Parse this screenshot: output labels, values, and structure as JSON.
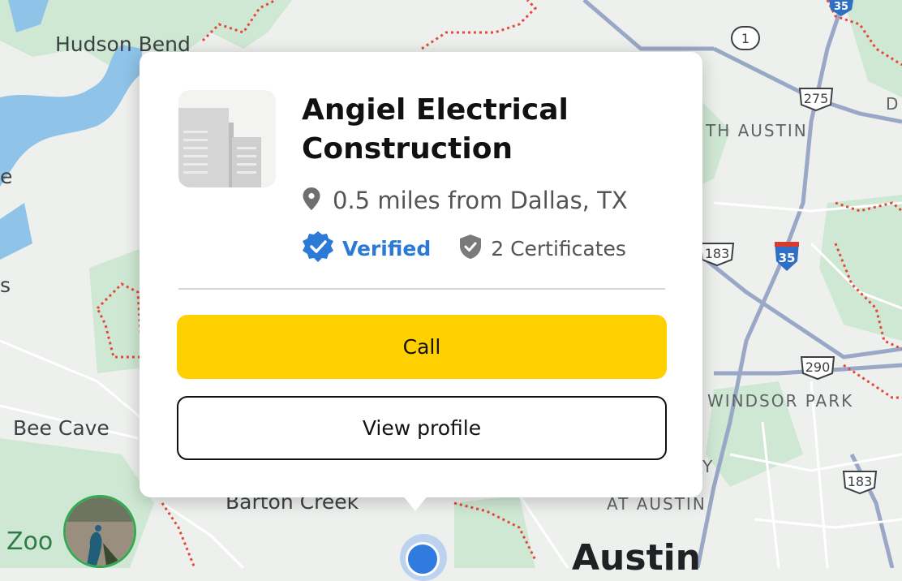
{
  "map": {
    "labels": {
      "hudson_bend": "Hudson Bend",
      "bee_cave": "Bee Cave",
      "barton_creek": "Barton Creek",
      "zoo": "Zoo",
      "north_austin": "TH AUSTIN",
      "windsor_park": "WINDSOR PARK",
      "at_austin": "AT AUSTIN",
      "austin": "Austin",
      "edge_e": "e",
      "edge_s": "s",
      "edge_d": "D",
      "edge_y": "Y"
    },
    "shields": {
      "r1": "1",
      "r35_top": "35",
      "r275": "275",
      "r183_mid": "183",
      "r35_mid": "35",
      "r290": "290",
      "r183_low": "183"
    },
    "colors": {
      "water": "#8fc3e8",
      "park": "#cfe8d3",
      "road": "#ffffff",
      "highway": "#9aa8c7",
      "boundary": "#e14a3a"
    }
  },
  "popup": {
    "business_name": "Angiel Electrical Construction",
    "distance": "0.5 miles from Dallas, TX",
    "verified_label": "Verified",
    "certificates_label": "2 Certificates",
    "call_label": "Call",
    "view_profile_label": "View profile",
    "accent_call": "#ffd000",
    "accent_verified": "#2b7bd6"
  },
  "icons": [
    "location-pin-icon",
    "verified-badge-icon",
    "certificate-shield-icon",
    "building-logo-icon",
    "zoo-photo-icon",
    "current-location-icon"
  ]
}
